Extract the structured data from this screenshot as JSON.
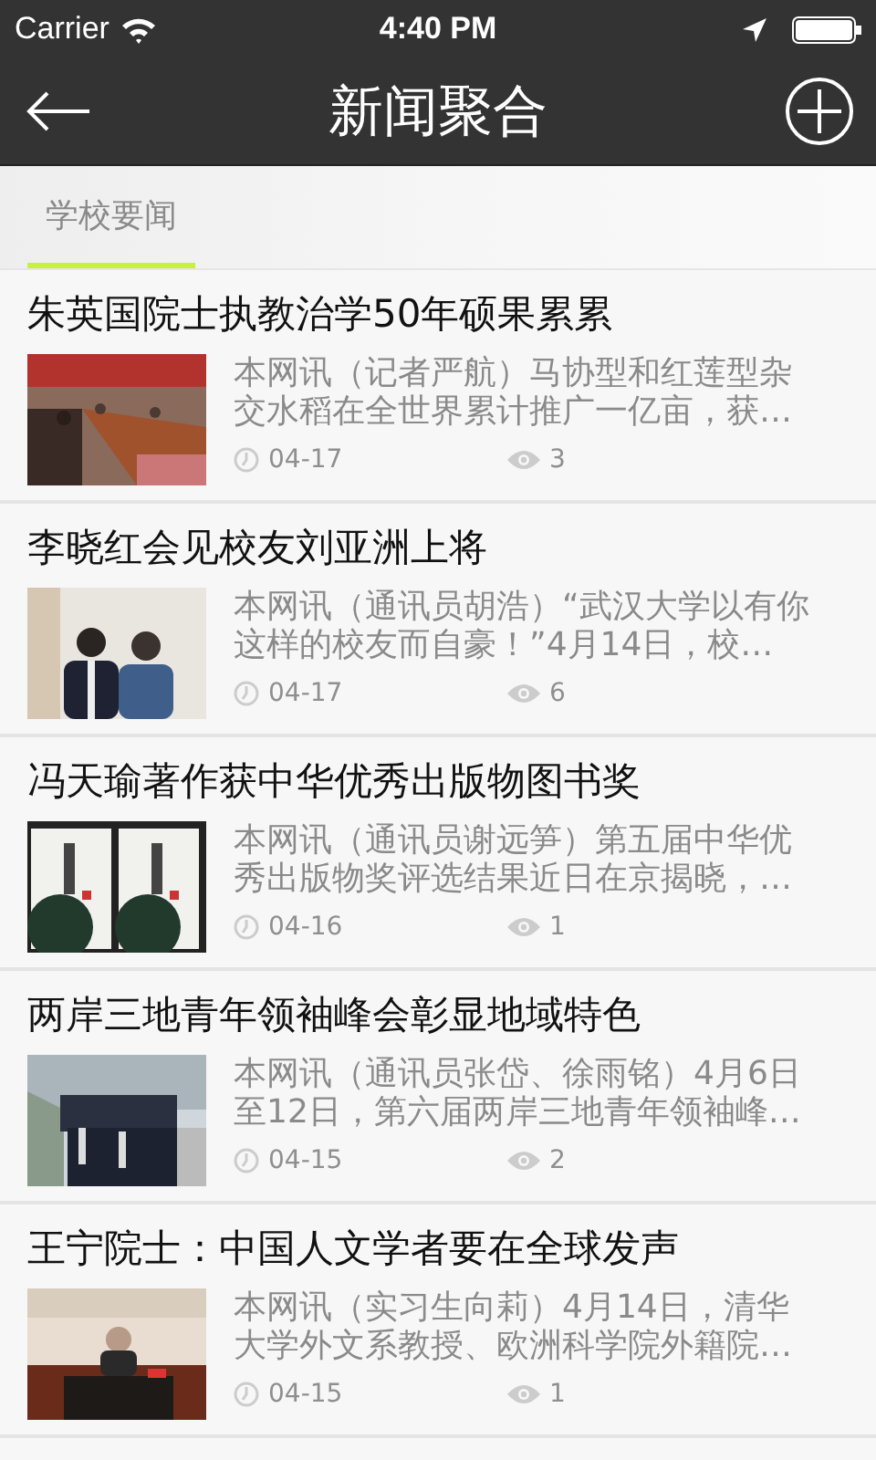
{
  "status_bar": {
    "carrier": "Carrier",
    "time": "4:40 PM"
  },
  "nav_bar": {
    "title": "新闻聚合"
  },
  "tabs": [
    {
      "label": "学校要闻",
      "selected": true
    }
  ],
  "articles": [
    {
      "title": "朱英国院士执教治学50年硕果累累",
      "summary": "本网讯（记者严航）马协型和红莲型杂交水稻在全世界累计推广一亿亩，获…",
      "date": "04-17",
      "views": "3"
    },
    {
      "title": "李晓红会见校友刘亚洲上将",
      "summary": "本网讯（通讯员胡浩）“武汉大学以有你这样的校友而自豪！”4月14日，校…",
      "date": "04-17",
      "views": "6"
    },
    {
      "title": "冯天瑜著作获中华优秀出版物图书奖",
      "summary": "本网讯（通讯员谢远笋）第五届中华优秀出版物奖评选结果近日在京揭晓，…",
      "date": "04-16",
      "views": "1"
    },
    {
      "title": "两岸三地青年领袖峰会彰显地域特色",
      "summary": "本网讯（通讯员张岱、徐雨铭）4月6日至12日，第六届两岸三地青年领袖峰…",
      "date": "04-15",
      "views": "2"
    },
    {
      "title": "王宁院士：中国人文学者要在全球发声",
      "summary": "本网讯（实习生向莉）4月14日，清华大学外文系教授、欧洲科学院外籍院…",
      "date": "04-15",
      "views": "1"
    }
  ]
}
